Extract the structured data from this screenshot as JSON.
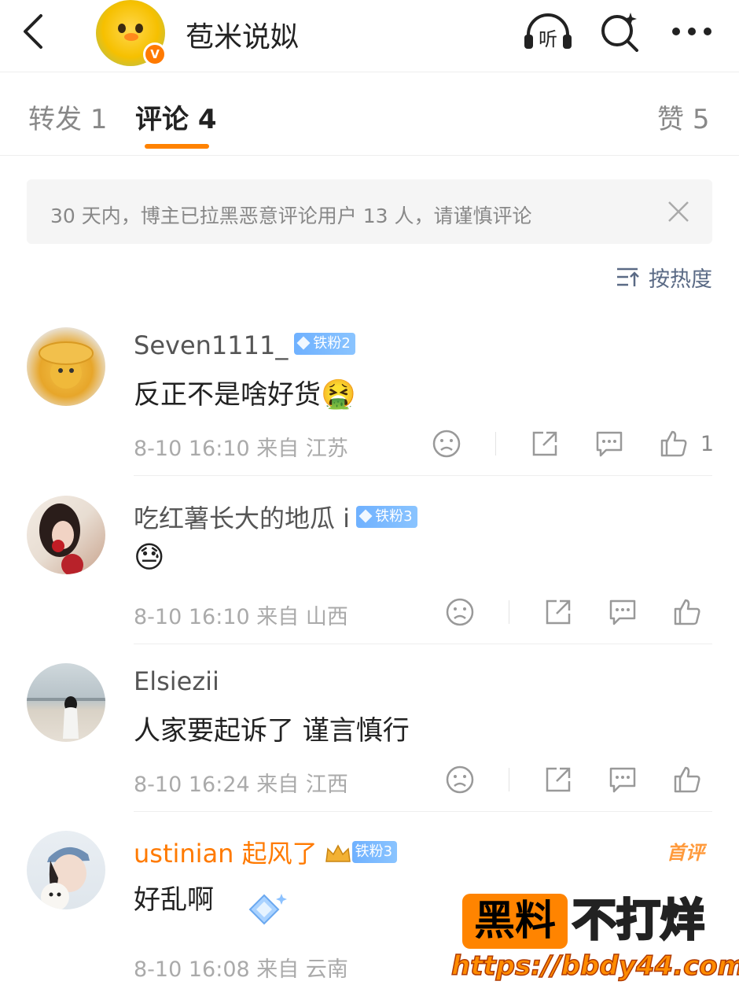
{
  "header": {
    "account_name": "苞米说姒",
    "listen_label": "听",
    "verified_badge": "V",
    "icons": [
      "back-arrow-icon",
      "listen-headphones-icon",
      "search-sparkle-icon",
      "more-dots-icon"
    ]
  },
  "tabs": [
    {
      "label": "转发",
      "count": "1"
    },
    {
      "label": "评论",
      "count": "4",
      "active": true
    },
    {
      "label": "赞",
      "count": "5"
    }
  ],
  "notice": {
    "text": "30 天内，博主已拉黑恶意评论用户 13 人，请谨慎评论"
  },
  "sort": {
    "label": "按热度"
  },
  "comments": [
    {
      "user": "Seven1111_",
      "badge": "铁粉2",
      "text": "反正不是啥好货",
      "emoji": "🤮",
      "time": "8-10 16:10",
      "from": "来自",
      "location": "江苏",
      "likes": "1"
    },
    {
      "user": "吃红薯长大的地瓜 i",
      "badge": "铁粉3",
      "text": "",
      "emoji": "😓",
      "time": "8-10 16:10",
      "from": "来自",
      "location": "山西",
      "likes": ""
    },
    {
      "user": "Elsiezii",
      "badge": "",
      "text": "人家要起诉了 谨言慎行",
      "emoji": "",
      "time": "8-10 16:24",
      "from": "来自",
      "location": "江西",
      "likes": ""
    },
    {
      "user": "ustinian 起风了",
      "badge": "铁粉3",
      "text": "好乱啊",
      "emoji": "",
      "time": "8-10 16:08",
      "from": "来自",
      "location": "云南",
      "likes": "",
      "first_badge": "首评"
    }
  ],
  "watermark": {
    "box_text": "黑料",
    "right_text": "不打烊",
    "url": "https://bbdy44.com"
  },
  "colors": {
    "accent": "#ff8200",
    "fan_badge": "#7bb8ff",
    "username_orange": "#ff7a00",
    "meta_gray": "#aaaaaa"
  }
}
